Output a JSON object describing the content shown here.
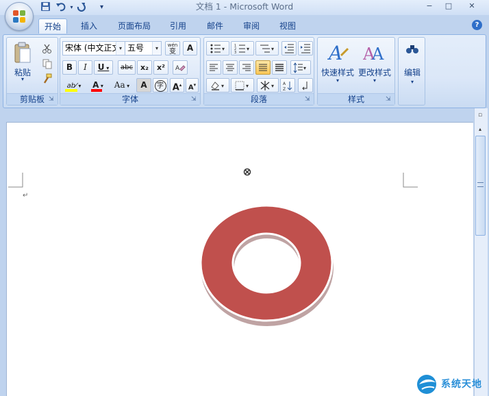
{
  "window": {
    "title": "文档 1 - Microsoft Word",
    "controls": {
      "minimize": "−",
      "maximize": "□",
      "close": "✕"
    }
  },
  "quick_access": {
    "save_icon": "save-icon",
    "undo_icon": "undo-icon",
    "redo_icon": "redo-icon",
    "customize": "▾"
  },
  "tabs": [
    {
      "label": "开始",
      "active": true
    },
    {
      "label": "插入"
    },
    {
      "label": "页面布局"
    },
    {
      "label": "引用"
    },
    {
      "label": "邮件"
    },
    {
      "label": "审阅"
    },
    {
      "label": "视图"
    }
  ],
  "help": "?",
  "ribbon": {
    "clipboard": {
      "label": "剪贴板",
      "paste": "粘贴"
    },
    "font": {
      "label": "字体",
      "font_name": "宋体 (中文正文)",
      "font_size": "五号",
      "wen": "wén",
      "wen_char": "变",
      "a_box": "A",
      "bold": "B",
      "italic": "I",
      "underline": "U",
      "strike": "abc",
      "subscript": "x₂",
      "superscript": "x²",
      "highlight": "ab⁄",
      "font_color": "A",
      "change_case": "Aa",
      "char_shading": "A",
      "enclose": "字",
      "grow": "A",
      "shrink": "A"
    },
    "paragraph": {
      "label": "段落"
    },
    "styles": {
      "label": "样式",
      "quick_styles": "快速样式",
      "change_styles": "更改样式"
    },
    "editing": {
      "label": "编辑"
    }
  },
  "document": {
    "paragraph_mark": "↵",
    "shape": {
      "type": "donut",
      "fill": "#c0504d",
      "shadow": "#bfa3a3"
    }
  },
  "colors": {
    "accent": "#15428b",
    "highlight_bar": "#ffff00",
    "font_color_bar": "#ff0000"
  },
  "watermark": {
    "text": "系统天地"
  }
}
